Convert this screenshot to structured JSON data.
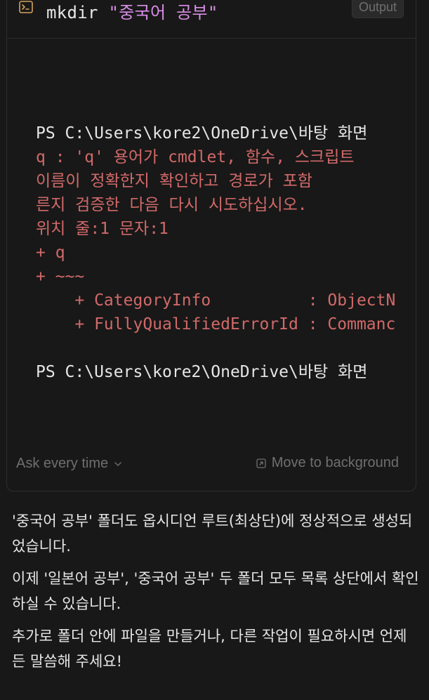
{
  "header": {
    "icon": "terminal-icon",
    "command_prefix": "mkdir ",
    "command_arg": "\"중국어 공부\"",
    "output_label": "Output"
  },
  "terminal": {
    "lines": [
      {
        "kind": "ps",
        "text": "PS C:\\Users\\kore2\\OneDrive\\바탕 화면"
      },
      {
        "kind": "err",
        "text": "q : 'q' 용어가 cmdlet, 함수, 스크립트"
      },
      {
        "kind": "err",
        "text": "이름이 정확한지 확인하고 경로가 포함"
      },
      {
        "kind": "err",
        "text": "른지 검증한 다음 다시 시도하십시오."
      },
      {
        "kind": "err",
        "text": "위치 줄:1 문자:1"
      },
      {
        "kind": "err",
        "text": "+ q"
      },
      {
        "kind": "err",
        "text": "+ ~~~"
      },
      {
        "kind": "err",
        "text": "    + CategoryInfo          : ObjectN"
      },
      {
        "kind": "err",
        "text": "    + FullyQualifiedErrorId : Commanc"
      },
      {
        "kind": "blank",
        "text": ""
      },
      {
        "kind": "ps",
        "text": "PS C:\\Users\\kore2\\OneDrive\\바탕 화면"
      }
    ]
  },
  "footer": {
    "ask_label": "Ask every time",
    "move_label": "Move to background"
  },
  "message": {
    "paragraphs": [
      "'중국어 공부' 폴더도 옵시디언 루트(최상단)에 정상적으로 생성되었습니다.",
      "이제 '일본어 공부', '중국어 공부' 두 폴더 모두 목록 상단에서 확인하실 수 있습니다.",
      "추가로 폴더 안에 파일을 만들거나, 다른 작업이 필요하시면 언제든 말씀해 주세요!"
    ]
  },
  "colors": {
    "background": "#181818",
    "error_text": "#d16969",
    "string_literal": "#d98ee6",
    "muted_text": "#6f6f6f"
  }
}
